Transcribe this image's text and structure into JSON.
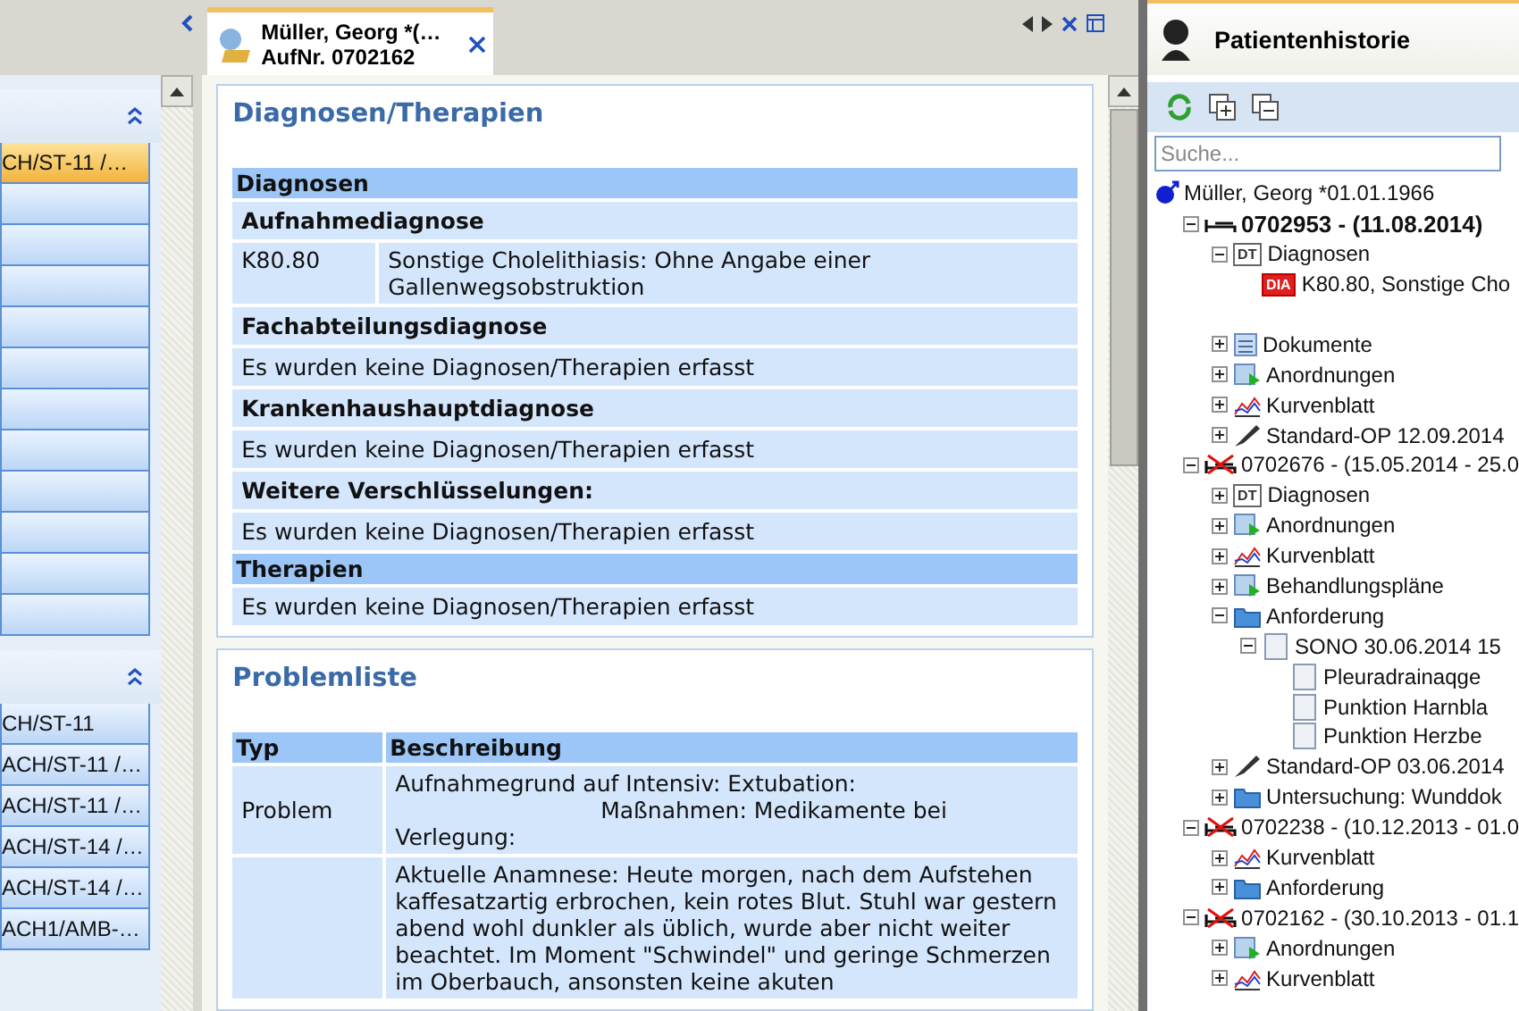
{
  "sidebar": {
    "groups": [
      {
        "expanded": true,
        "items": [
          {
            "label": "CH/ST-11 /…",
            "selected": true
          },
          {
            "selected": false
          },
          {
            "selected": false
          },
          {
            "selected": false
          },
          {
            "selected": false
          },
          {
            "selected": false
          },
          {
            "selected": false
          },
          {
            "selected": false
          },
          {
            "selected": false
          },
          {
            "selected": false
          },
          {
            "selected": false
          },
          {
            "selected": false
          }
        ]
      },
      {
        "expanded": true,
        "items": [
          {
            "label": "CH/ST-11",
            "selected": false
          },
          {
            "label": "ACH/ST-11 /…",
            "selected": false
          },
          {
            "label": "ACH/ST-11 /…",
            "selected": false
          },
          {
            "label": "ACH/ST-14 /…",
            "selected": false
          },
          {
            "label": "ACH/ST-14 /…",
            "selected": false
          },
          {
            "label": "ACH1/AMB-…",
            "selected": false
          }
        ]
      }
    ]
  },
  "tabs": [
    {
      "title": "Müller, Georg *(…",
      "subtitle": "AufNr. 0702162",
      "selected": true
    }
  ],
  "diagnoses_card": {
    "title": "Diagnosen/Therapien",
    "rows": [
      {
        "kind": "section",
        "text": "Diagnosen"
      },
      {
        "kind": "subheading",
        "text": "Aufnahmediagnose"
      },
      {
        "kind": "code",
        "code": "K80.80",
        "text": "Sonstige Cholelithiasis: Ohne Angabe einer Gallenwegsobstruktion"
      },
      {
        "kind": "subheading",
        "text": "Fachabteilungsdiagnose"
      },
      {
        "kind": "note",
        "text": "Es wurden keine Diagnosen/Therapien erfasst"
      },
      {
        "kind": "subheading",
        "text": "Krankenhaushauptdiagnose"
      },
      {
        "kind": "note",
        "text": "Es wurden keine Diagnosen/Therapien erfasst"
      },
      {
        "kind": "subheading",
        "text": "Weitere Verschlüsselungen:"
      },
      {
        "kind": "note",
        "text": "Es wurden keine Diagnosen/Therapien erfasst"
      },
      {
        "kind": "section",
        "text": "Therapien"
      },
      {
        "kind": "note",
        "text": "Es wurden keine Diagnosen/Therapien erfasst"
      }
    ]
  },
  "problem_card": {
    "title": "Problemliste",
    "columns": [
      "Typ",
      "Beschreibung"
    ],
    "rows": [
      {
        "type": "Problem",
        "lines": [
          "Aufnahmegrund auf Intensiv: Extubation:",
          "Maßnahmen: Medikamente bei",
          "Verlegung:"
        ]
      },
      {
        "type": "",
        "lines": [
          "Aktuelle Anamnese: Heute morgen, nach dem Aufstehen kaffesatzartig erbrochen, kein rotes Blut. Stuhl war gestern abend wohl dunkler als üblich, wurde aber nicht weiter beachtet. Im Moment \"Schwindel\" und geringe Schmerzen im Oberbauch, ansonsten keine akuten"
        ]
      }
    ]
  },
  "history": {
    "title": "Patientenhistorie",
    "search": {
      "placeholder": "Suche..."
    },
    "tree": [
      {
        "kind": "patient",
        "label": "Müller, Georg *01.01.1966",
        "children": [
          {
            "kind": "case",
            "closed": false,
            "expanded": true,
            "label": "0702953 - (11.08.2014)",
            "children": [
              {
                "kind": "dt",
                "badge": "DT",
                "expanded": true,
                "label": "Diagnosen",
                "children": [
                  {
                    "kind": "dia",
                    "badge": "DIA",
                    "label": "K80.80, Sonstige Cho"
                  },
                  {
                    "kind": "blank"
                  }
                ]
              },
              {
                "kind": "docs",
                "expanded": false,
                "label": "Dokumente"
              },
              {
                "kind": "orders",
                "expanded": false,
                "label": "Anordnungen"
              },
              {
                "kind": "chart",
                "expanded": false,
                "label": "Kurvenblatt"
              },
              {
                "kind": "surgery",
                "expanded": false,
                "label": "Standard-OP 12.09.2014"
              }
            ]
          },
          {
            "kind": "case",
            "closed": true,
            "expanded": true,
            "label": "0702676 - (15.05.2014 - 25.0",
            "children": [
              {
                "kind": "dt",
                "badge": "DT",
                "expanded": false,
                "label": "Diagnosen"
              },
              {
                "kind": "orders",
                "expanded": false,
                "label": "Anordnungen"
              },
              {
                "kind": "chart",
                "expanded": false,
                "label": "Kurvenblatt"
              },
              {
                "kind": "orders",
                "expanded": false,
                "label": "Behandlungspläne"
              },
              {
                "kind": "folder",
                "expanded": true,
                "label": "Anforderung",
                "children": [
                  {
                    "kind": "sheet",
                    "expanded": true,
                    "label": "SONO 30.06.2014 15",
                    "children": [
                      {
                        "kind": "sheet",
                        "label": "Pleuradrainaqge"
                      },
                      {
                        "kind": "sheet",
                        "label": "Punktion Harnbla"
                      },
                      {
                        "kind": "sheet",
                        "label": "Punktion Herzbe"
                      }
                    ]
                  }
                ]
              },
              {
                "kind": "surgery",
                "expanded": false,
                "label": "Standard-OP 03.06.2014"
              },
              {
                "kind": "folder",
                "expanded": false,
                "label": "Untersuchung: Wunddok"
              }
            ]
          },
          {
            "kind": "case",
            "closed": true,
            "expanded": true,
            "label": "0702238 - (10.12.2013 - 01.0",
            "children": [
              {
                "kind": "chart",
                "expanded": false,
                "label": "Kurvenblatt"
              },
              {
                "kind": "folder",
                "expanded": false,
                "label": "Anforderung"
              }
            ]
          },
          {
            "kind": "case",
            "closed": true,
            "expanded": true,
            "label": "0702162 - (30.10.2013 - 01.1",
            "children": [
              {
                "kind": "orders",
                "expanded": false,
                "label": "Anordnungen"
              },
              {
                "kind": "chart",
                "expanded": false,
                "label": "Kurvenblatt"
              }
            ]
          }
        ]
      }
    ]
  }
}
